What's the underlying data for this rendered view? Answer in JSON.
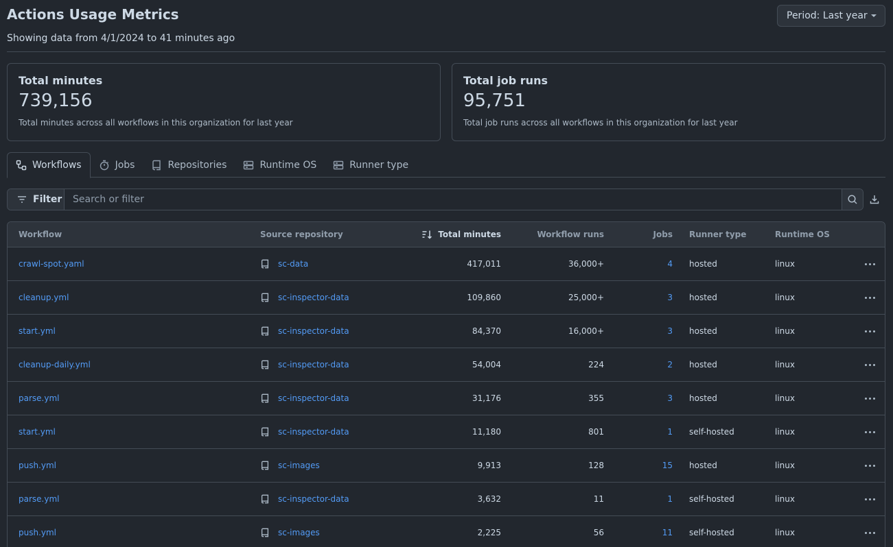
{
  "header": {
    "title": "Actions Usage Metrics",
    "subtitle": "Showing data from 4/1/2024 to 41 minutes ago",
    "period_label": "Period: Last year"
  },
  "cards": [
    {
      "title": "Total minutes",
      "value": "739,156",
      "desc": "Total minutes across all workflows in this organization for last year"
    },
    {
      "title": "Total job runs",
      "value": "95,751",
      "desc": "Total job runs across all workflows in this organization for last year"
    }
  ],
  "tabs": [
    {
      "label": "Workflows",
      "icon": "workflow-icon"
    },
    {
      "label": "Jobs",
      "icon": "stopwatch-icon"
    },
    {
      "label": "Repositories",
      "icon": "repo-icon"
    },
    {
      "label": "Runtime OS",
      "icon": "server-icon"
    },
    {
      "label": "Runner type",
      "icon": "server-icon"
    }
  ],
  "filter": {
    "label": "Filter",
    "placeholder": "Search or filter"
  },
  "table": {
    "headers": {
      "workflow": "Workflow",
      "repo": "Source repository",
      "minutes": "Total minutes",
      "runs": "Workflow runs",
      "jobs": "Jobs",
      "runner": "Runner type",
      "os": "Runtime OS"
    },
    "rows": [
      {
        "workflow": "crawl-spot.yaml",
        "repo": "sc-data",
        "minutes": "417,011",
        "runs": "36,000+",
        "jobs": "4",
        "runner": "hosted",
        "os": "linux"
      },
      {
        "workflow": "cleanup.yml",
        "repo": "sc-inspector-data",
        "minutes": "109,860",
        "runs": "25,000+",
        "jobs": "3",
        "runner": "hosted",
        "os": "linux"
      },
      {
        "workflow": "start.yml",
        "repo": "sc-inspector-data",
        "minutes": "84,370",
        "runs": "16,000+",
        "jobs": "3",
        "runner": "hosted",
        "os": "linux"
      },
      {
        "workflow": "cleanup-daily.yml",
        "repo": "sc-inspector-data",
        "minutes": "54,004",
        "runs": "224",
        "jobs": "2",
        "runner": "hosted",
        "os": "linux"
      },
      {
        "workflow": "parse.yml",
        "repo": "sc-inspector-data",
        "minutes": "31,176",
        "runs": "355",
        "jobs": "3",
        "runner": "hosted",
        "os": "linux"
      },
      {
        "workflow": "start.yml",
        "repo": "sc-inspector-data",
        "minutes": "11,180",
        "runs": "801",
        "jobs": "1",
        "runner": "self-hosted",
        "os": "linux"
      },
      {
        "workflow": "push.yml",
        "repo": "sc-images",
        "minutes": "9,913",
        "runs": "128",
        "jobs": "15",
        "runner": "hosted",
        "os": "linux"
      },
      {
        "workflow": "parse.yml",
        "repo": "sc-inspector-data",
        "minutes": "3,632",
        "runs": "11",
        "jobs": "1",
        "runner": "self-hosted",
        "os": "linux"
      },
      {
        "workflow": "push.yml",
        "repo": "sc-images",
        "minutes": "2,225",
        "runs": "56",
        "jobs": "11",
        "runner": "self-hosted",
        "os": "linux"
      }
    ]
  },
  "colors": {
    "background": "#22272e",
    "border": "#444c56",
    "link": "#539bf5",
    "text": "#cdd9e5"
  }
}
